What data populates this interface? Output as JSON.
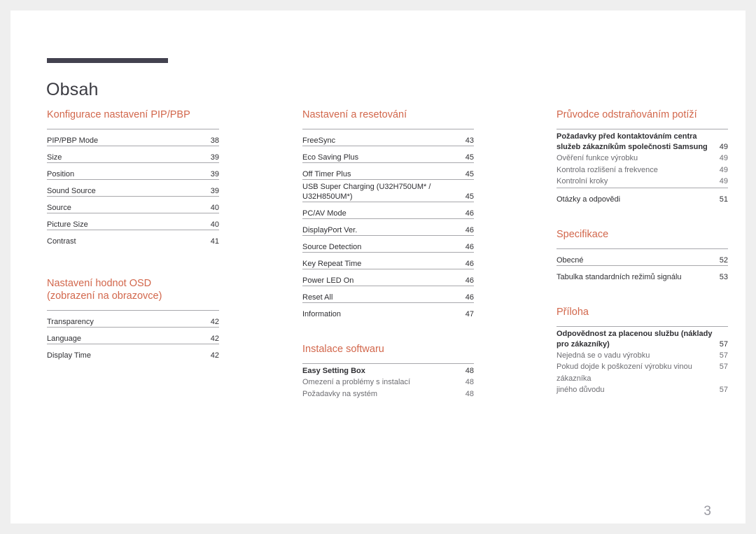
{
  "document": {
    "title": "Obsah",
    "page_number": "3",
    "accent_color": "#d2674c",
    "rule_color": "#43424f",
    "text_color": "#2f2f33",
    "subtext_color": "#6d6d72"
  },
  "columns": [
    {
      "id": "column-1",
      "sections": [
        {
          "heading": "Konfigurace nastavení PIP/PBP",
          "entries": [
            {
              "label": "PIP/PBP Mode",
              "page": "38",
              "level": "main"
            },
            {
              "label": "Size",
              "page": "39",
              "level": "main"
            },
            {
              "label": "Position",
              "page": "39",
              "level": "main"
            },
            {
              "label": "Sound Source",
              "page": "39",
              "level": "main"
            },
            {
              "label": "Source",
              "page": "40",
              "level": "main"
            },
            {
              "label": "Picture Size",
              "page": "40",
              "level": "main"
            },
            {
              "label": "Contrast",
              "page": "41",
              "level": "main"
            }
          ]
        },
        {
          "heading": "Nastavení hodnot OSD\n(zobrazení na obrazovce)",
          "entries": [
            {
              "label": "Transparency",
              "page": "42",
              "level": "main"
            },
            {
              "label": "Language",
              "page": "42",
              "level": "main"
            },
            {
              "label": "Display Time",
              "page": "42",
              "level": "main"
            }
          ]
        }
      ]
    },
    {
      "id": "column-2",
      "sections": [
        {
          "heading": "Nastavení a resetování",
          "entries": [
            {
              "label": "FreeSync",
              "page": "43",
              "level": "main"
            },
            {
              "label": "Eco Saving Plus",
              "page": "45",
              "level": "main"
            },
            {
              "label": "Off Timer Plus",
              "page": "45",
              "level": "main"
            },
            {
              "label": "USB Super Charging (U32H750UM* / U32H850UM*)",
              "page": "45",
              "level": "main"
            },
            {
              "label": "PC/AV Mode",
              "page": "46",
              "level": "main"
            },
            {
              "label": "DisplayPort Ver.",
              "page": "46",
              "level": "main"
            },
            {
              "label": "Source Detection",
              "page": "46",
              "level": "main"
            },
            {
              "label": "Key Repeat Time",
              "page": "46",
              "level": "main"
            },
            {
              "label": "Power LED On",
              "page": "46",
              "level": "main"
            },
            {
              "label": "Reset All",
              "page": "46",
              "level": "main"
            },
            {
              "label": "Information",
              "page": "47",
              "level": "main"
            }
          ]
        },
        {
          "heading": "Instalace softwaru",
          "entries": [
            {
              "label": "Easy Setting Box",
              "page": "48",
              "level": "lead"
            },
            {
              "label": "Omezení a problémy s instalací",
              "page": "48",
              "level": "sub"
            },
            {
              "label": "Požadavky na systém",
              "page": "48",
              "level": "sub"
            }
          ]
        }
      ]
    },
    {
      "id": "column-3",
      "sections": [
        {
          "heading": "Průvodce odstraňováním potíží",
          "entries": [
            {
              "label": "Požadavky před kontaktováním centra služeb zákazníkům společnosti Samsung",
              "page": "49",
              "level": "lead"
            },
            {
              "label": "Ověření funkce výrobku",
              "page": "49",
              "level": "sub"
            },
            {
              "label": "Kontrola rozlišení a frekvence",
              "page": "49",
              "level": "sub"
            },
            {
              "label": "Kontrolní kroky",
              "page": "49",
              "level": "sub"
            },
            {
              "label": "Otázky a odpovědi",
              "page": "51",
              "level": "main"
            }
          ]
        },
        {
          "heading": "Specifikace",
          "entries": [
            {
              "label": "Obecné",
              "page": "52",
              "level": "main"
            },
            {
              "label": "Tabulka standardních režimů signálu",
              "page": "53",
              "level": "main"
            }
          ]
        },
        {
          "heading": "Příloha",
          "entries": [
            {
              "label": "Odpovědnost za placenou službu (náklady pro zákazníky)",
              "page": "57",
              "level": "lead"
            },
            {
              "label": "Nejedná se o vadu výrobku",
              "page": "57",
              "level": "sub"
            },
            {
              "label": "Pokud dojde k poškození výrobku vinou zákazníka",
              "page": "57",
              "level": "sub"
            },
            {
              "label": "jiného důvodu",
              "page": "57",
              "level": "sub"
            }
          ]
        }
      ]
    }
  ]
}
